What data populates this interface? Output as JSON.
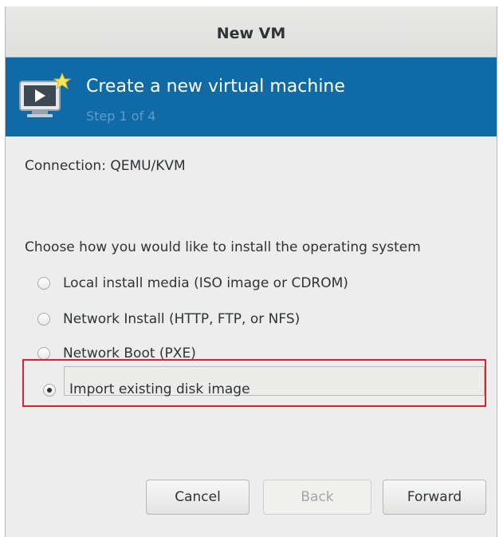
{
  "window": {
    "title": "New VM"
  },
  "banner": {
    "icon": "vm-monitor-icon",
    "heading": "Create a new virtual machine",
    "step": "Step 1 of 4",
    "color": "#0f6aa6"
  },
  "connection": {
    "text": "Connection:  QEMU/KVM"
  },
  "install": {
    "prompt": "Choose how you would like to install the operating system",
    "options": [
      {
        "label": "Local install media (ISO image or CDROM)",
        "selected": false
      },
      {
        "label": "Network Install (HTTP, FTP, or NFS)",
        "selected": false
      },
      {
        "label": "Network Boot (PXE)",
        "selected": false
      },
      {
        "label": "Import existing disk image",
        "selected": true
      }
    ]
  },
  "buttons": {
    "cancel": "Cancel",
    "back": "Back",
    "forward": "Forward"
  },
  "highlight": {
    "color": "#e0212b"
  }
}
